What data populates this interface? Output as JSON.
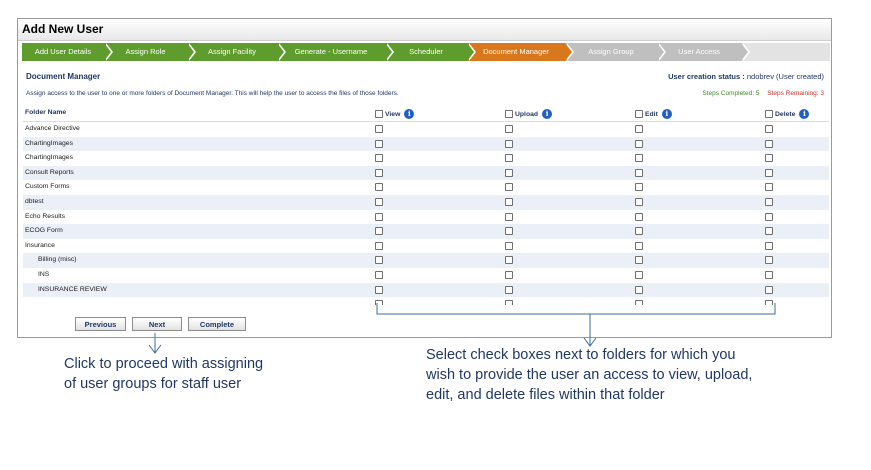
{
  "window": {
    "title": "Add New User"
  },
  "steps": [
    {
      "label": "Add User Details",
      "state": "done"
    },
    {
      "label": "Assign Role",
      "state": "done"
    },
    {
      "label": "Assign Facility",
      "state": "done"
    },
    {
      "label": "Generate - Username",
      "state": "done"
    },
    {
      "label": "Scheduler",
      "state": "done"
    },
    {
      "label": "Document Manager",
      "state": "active"
    },
    {
      "label": "Assign Group",
      "state": "todo"
    },
    {
      "label": "User Access",
      "state": "todo"
    }
  ],
  "section": {
    "title": "Document Manager",
    "status_label": "User creation status :",
    "status_value": "ndobrev (User created)",
    "description": "Assign access to the user to one or more folders of Document Manager. This will help the user to access the files of those folders.",
    "steps_completed": "Steps Completed: 5",
    "steps_remaining": "Steps Remaining: 3"
  },
  "table": {
    "header": {
      "folder": "Folder Name",
      "view": "View",
      "upload": "Upload",
      "edit": "Edit",
      "delete": "Delete",
      "info_glyph": "i"
    },
    "rows": [
      {
        "name": "Advance Directive",
        "sub": false
      },
      {
        "name": "ChartingImages",
        "sub": false
      },
      {
        "name": "ChartingImages",
        "sub": false
      },
      {
        "name": "Consult Reports",
        "sub": false
      },
      {
        "name": "Custom Forms",
        "sub": false
      },
      {
        "name": "dbtest",
        "sub": false
      },
      {
        "name": "Echo Results",
        "sub": false
      },
      {
        "name": "ECOG Form",
        "sub": false
      },
      {
        "name": "Insurance",
        "sub": false
      },
      {
        "name": "Billing (misc)",
        "sub": true
      },
      {
        "name": "INS",
        "sub": true
      },
      {
        "name": "INSURANCE REVIEW",
        "sub": true
      }
    ]
  },
  "buttons": {
    "previous": "Previous",
    "next": "Next",
    "complete": "Complete"
  },
  "captions": {
    "left": "Click to proceed with assigning of user groups for staff user",
    "right": "Select check boxes next to folders for which you wish to provide the user an access to view, upload, edit, and delete files within that folder"
  },
  "colors": {
    "done": "#5e9c2d",
    "active": "#d9771c",
    "todo": "#bfbfbf",
    "text": "#1f3864",
    "annotation": "#3a6ea5"
  },
  "icons": {
    "info": "info-circle-icon",
    "checkbox": "checkbox-icon"
  }
}
